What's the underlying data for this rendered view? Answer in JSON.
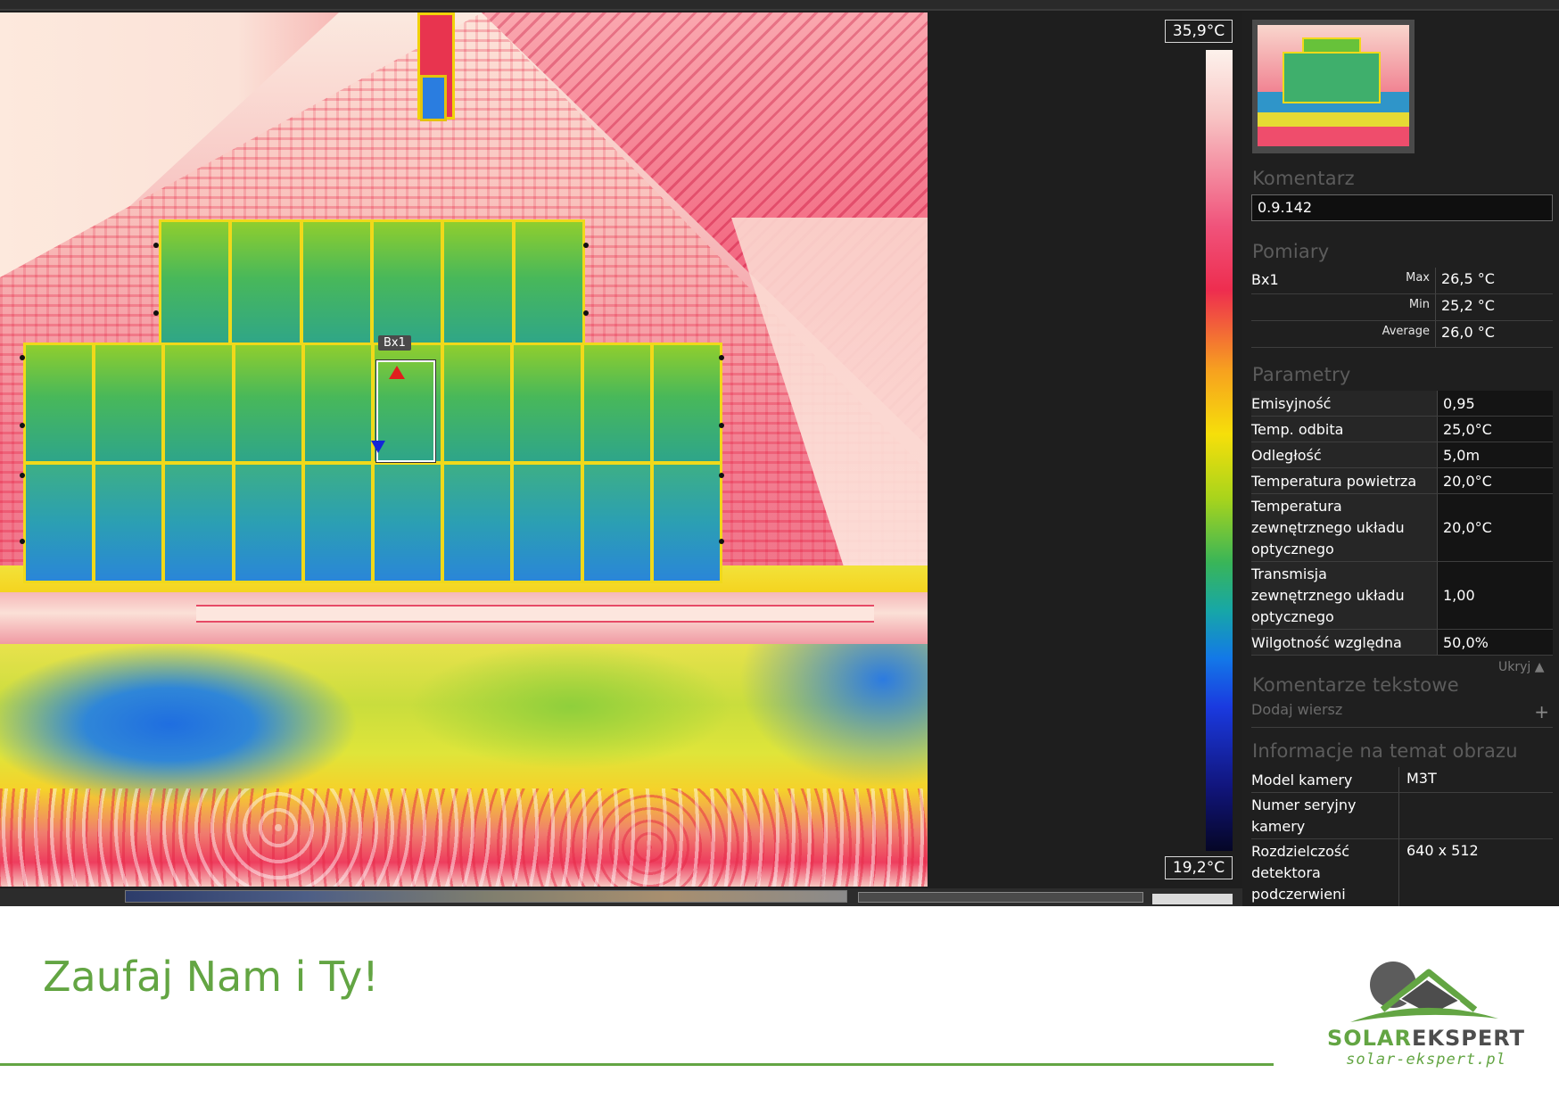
{
  "palette": {
    "max_label": "35,9°C",
    "min_label": "19,2°C"
  },
  "image": {
    "box_label": "Bx1"
  },
  "sidebar": {
    "comment_title": "Komentarz",
    "comment_value": "0.9.142",
    "measurements_title": "Pomiary",
    "measurement_name": "Bx1",
    "measurements": [
      {
        "label": "Max",
        "value": "26,5 °C"
      },
      {
        "label": "Min",
        "value": "25,2 °C"
      },
      {
        "label": "Average",
        "value": "26,0 °C"
      }
    ],
    "parameters_title": "Parametry",
    "parameters": [
      {
        "label": "Emisyjność",
        "value": "0,95"
      },
      {
        "label": "Temp. odbita",
        "value": "25,0°C"
      },
      {
        "label": "Odległość",
        "value": "5,0m"
      },
      {
        "label": "Temperatura powietrza",
        "value": "20,0°C"
      },
      {
        "label_lines": [
          "Temperatura",
          "zewnętrznego układu",
          "optycznego"
        ],
        "value": "20,0°C"
      },
      {
        "label_lines": [
          "Transmisja",
          "zewnętrznego układu",
          "optycznego"
        ],
        "value": "1,00"
      },
      {
        "label": "Wilgotność względna",
        "value": "50,0%"
      }
    ],
    "hide_label": "Ukryj ▲",
    "text_comments_title": "Komentarze tekstowe",
    "add_row_label": "Dodaj wiersz",
    "add_row_icon": "plus-icon",
    "info_title": "Informacje na temat obrazu",
    "info": [
      {
        "label": "Model kamery",
        "value": "M3T"
      },
      {
        "label_lines": [
          "Numer seryjny",
          "kamery"
        ],
        "value": ""
      },
      {
        "label_lines": [
          "Rozdzielczość",
          "detektora",
          "podczerwieni"
        ],
        "value": "640 x 512"
      }
    ]
  },
  "footer": {
    "slogan": "Zaufaj Nam i Ty!",
    "logo_name_part1": "SOLAR",
    "logo_name_part2": "EKSPERT",
    "logo_url": "solar-ekspert.pl",
    "brand_green": "#63a543",
    "brand_gray": "#4d4d4d"
  }
}
